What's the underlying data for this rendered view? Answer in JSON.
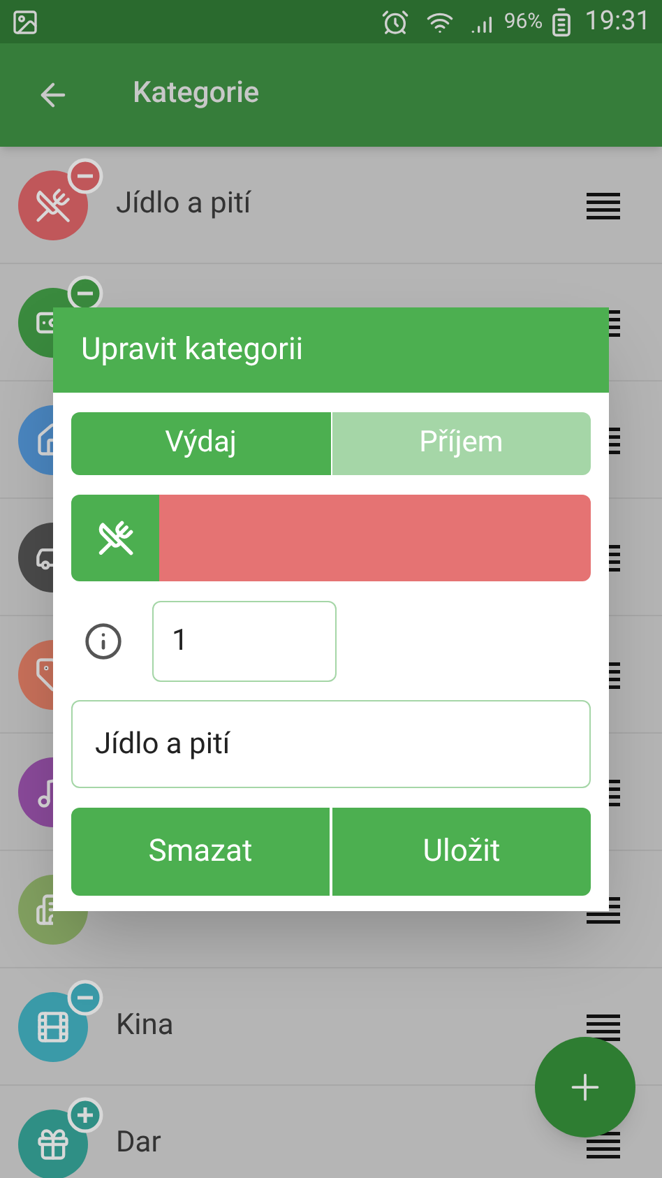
{
  "status_bar": {
    "battery": "96%",
    "time": "19:31"
  },
  "app_bar": {
    "title": "Kategorie"
  },
  "categories": [
    {
      "name": "Jídlo a pití",
      "color": "#c0575a",
      "kind": "minus"
    },
    {
      "color": "#3a8a3e",
      "kind": "minus"
    },
    {
      "color": "#4a86c0",
      "kind": "plain"
    },
    {
      "color": "#4a4a4a",
      "kind": "plain"
    },
    {
      "color": "#c8705a",
      "kind": "plain"
    },
    {
      "color": "#8a4a9a",
      "kind": "plain"
    },
    {
      "color": "#82a060",
      "kind": "plain"
    },
    {
      "name": "Kina",
      "color": "#3a9aa8",
      "kind": "minus"
    },
    {
      "name": "Dar",
      "color": "#2f8f85",
      "kind": "plus"
    }
  ],
  "dialog": {
    "title": "Upravit kategorii",
    "type_tabs": [
      {
        "label": "Výdaj",
        "selected": true
      },
      {
        "label": "Příjem",
        "selected": false
      }
    ],
    "color": "#e57373",
    "order": "1",
    "name": "Jídlo a pití",
    "buttons": [
      "Smazat",
      "Uložit"
    ]
  }
}
